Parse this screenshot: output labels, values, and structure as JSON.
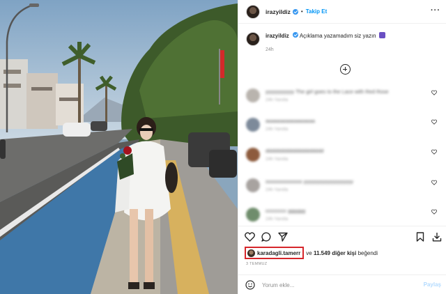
{
  "post": {
    "username": "irazyildiz",
    "follow_label": "Takip Et",
    "separator": "•",
    "more_label": "···",
    "caption_username": "irazyildiz",
    "caption_text": "Açıklama yazamadım siz yazın",
    "caption_time": "24h"
  },
  "comments": [
    {
      "text": "yyyyyyyyyyy The girl goes to the Lace with Red Rose",
      "meta": "24h   Yanıtla"
    },
    {
      "text": "aaaaaaaaaaaaaaaaa",
      "meta": "24h   Yanıtla"
    },
    {
      "text": "dddddddddddddddddddd",
      "meta": "24h   Yanıtla"
    },
    {
      "text": "ssssssssssssss yyyyyyyyyyyyyyyyyyy",
      "meta": "24h   Yanıtla"
    },
    {
      "text": "cccccccc gggggg",
      "meta": "24h   Yanıtla"
    }
  ],
  "likes": {
    "liker_name": "karadagli.tamerr",
    "rest_prefix": "ve",
    "count_text": "11.549 diğer kişi",
    "rest_suffix": "beğendi"
  },
  "date": "3 TEMMUZ",
  "comment_box": {
    "placeholder": "Yorum ekle...",
    "post_label": "Paylaş"
  },
  "icons": [
    "heart-icon",
    "comment-icon",
    "share-icon",
    "bookmark-icon",
    "download-icon",
    "smile-icon",
    "plus-icon",
    "more-icon",
    "verified-icon"
  ],
  "colors": {
    "accent": "#0095f6",
    "highlight": "#d6262b",
    "post_disabled": "#b3dbff"
  }
}
